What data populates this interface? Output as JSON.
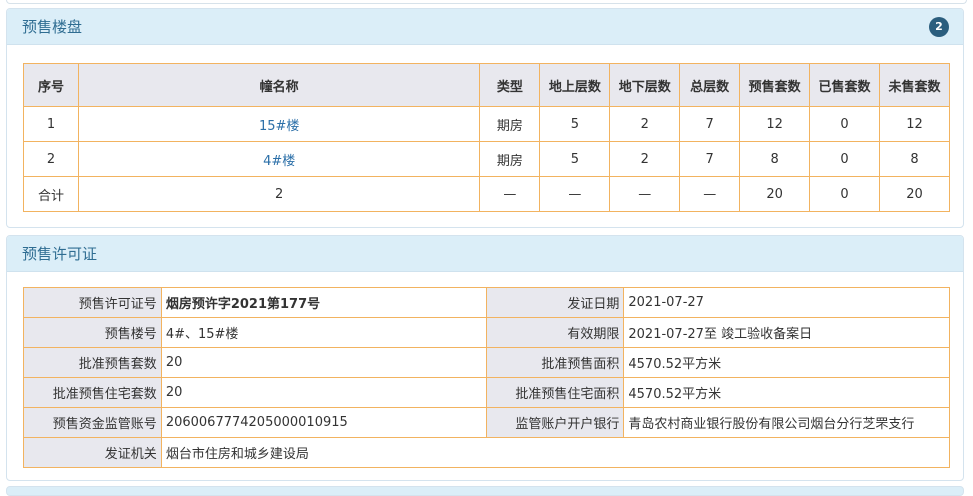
{
  "presale_buildings": {
    "title": "预售楼盘",
    "count_badge": "2",
    "headers": [
      "序号",
      "幢名称",
      "类型",
      "地上层数",
      "地下层数",
      "总层数",
      "预售套数",
      "已售套数",
      "未售套数"
    ],
    "rows": [
      [
        "1",
        "15#楼",
        "期房",
        "5",
        "2",
        "7",
        "12",
        "0",
        "12"
      ],
      [
        "2",
        "4#楼",
        "期房",
        "5",
        "2",
        "7",
        "8",
        "0",
        "8"
      ]
    ],
    "total": [
      "合计",
      "2",
      "—",
      "—",
      "—",
      "—",
      "20",
      "0",
      "20"
    ]
  },
  "permit": {
    "title": "预售许可证",
    "rows": [
      {
        "l1": "预售许可证号",
        "v1": "烟房预许字2021第177号",
        "l2": "发证日期",
        "v2": "2021-07-27"
      },
      {
        "l1": "预售楼号",
        "v1": "4#、15#楼",
        "l2": "有效期限",
        "v2": "2021-07-27至 竣工验收备案日"
      },
      {
        "l1": "批准预售套数",
        "v1": "20",
        "l2": "批准预售面积",
        "v2": "4570.52平方米"
      },
      {
        "l1": "批准预售住宅套数",
        "v1": "20",
        "l2": "批准预售住宅面积",
        "v2": "4570.52平方米"
      },
      {
        "l1": "预售资金监管账号",
        "v1": "206006777420500001091​5",
        "l2": "监管账户开户银行",
        "v2": "青岛农村商业银行股份有限公司烟台分行芝罘支行"
      }
    ],
    "issuer_label": "发证机关",
    "issuer_value": "烟台市住房和城乡建设局"
  }
}
